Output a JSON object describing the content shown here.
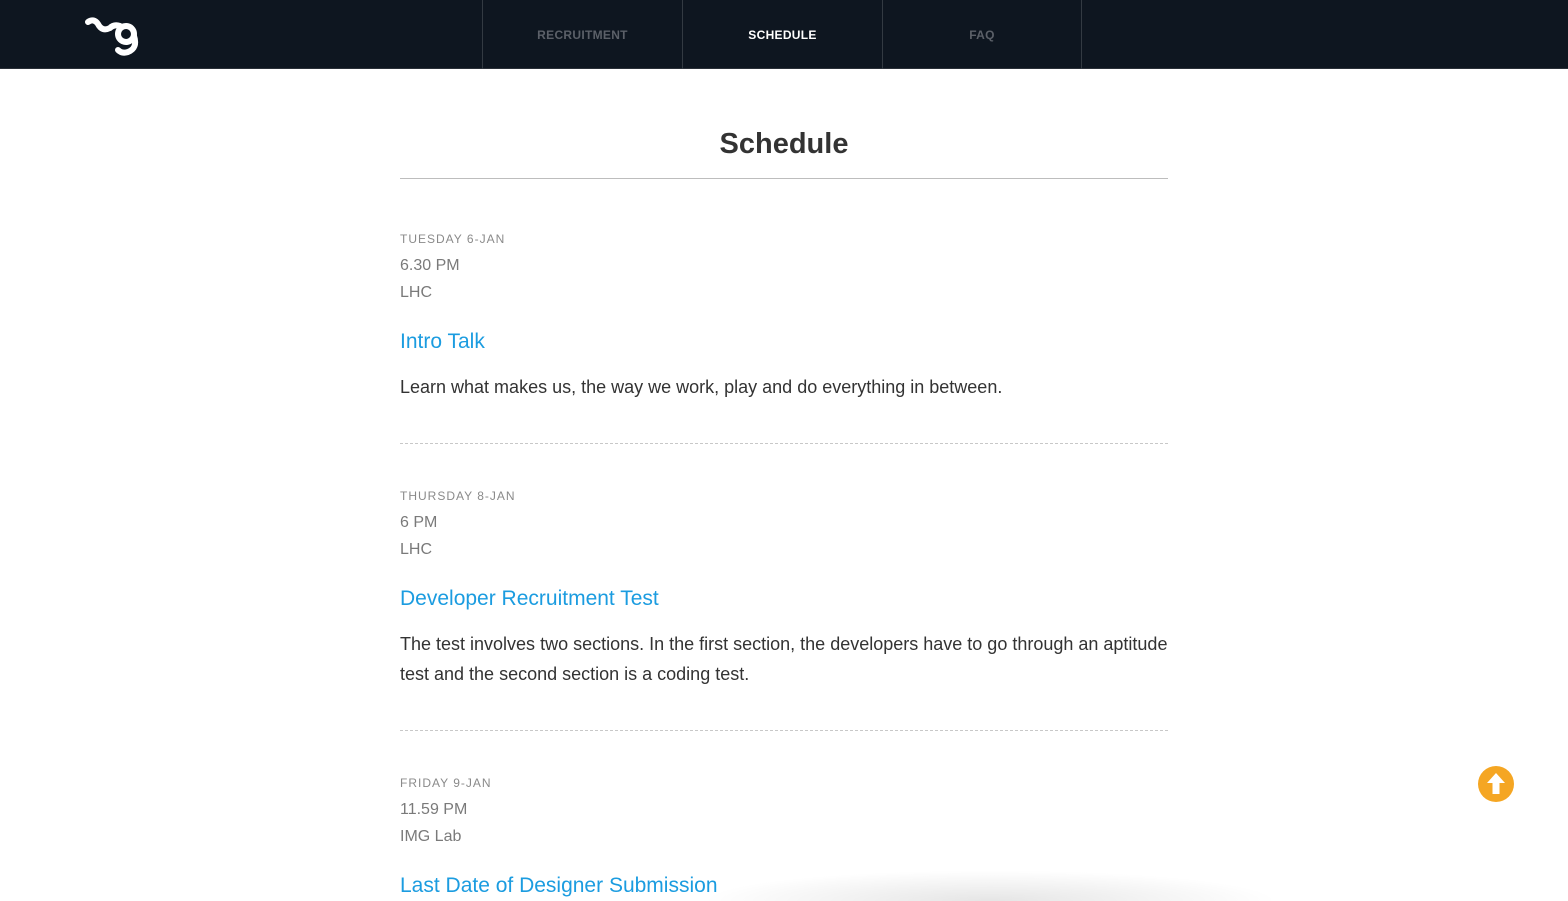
{
  "header": {
    "logo_icon": "img-logo-icon",
    "nav": [
      {
        "label": "RECRUITMENT",
        "active": false
      },
      {
        "label": "SCHEDULE",
        "active": true
      },
      {
        "label": "FAQ",
        "active": false
      }
    ]
  },
  "page": {
    "title": "Schedule"
  },
  "events": [
    {
      "day": "TUESDAY 6-JAN",
      "time": "6.30 PM",
      "place": "LHC",
      "title": "Intro Talk",
      "description": "Learn what makes us, the way we work, play and do everything in between."
    },
    {
      "day": "THURSDAY 8-JAN",
      "time": "6 PM",
      "place": "LHC",
      "title": "Developer Recruitment Test",
      "description": "The test involves two sections. In the first section, the developers have to go through an aptitude test and the second section is a coding test."
    },
    {
      "day": "FRIDAY 9-JAN",
      "time": "11.59 PM",
      "place": "IMG Lab",
      "title": "Last Date of Designer Submission",
      "description": ""
    }
  ],
  "scroll_top": {
    "icon": "arrow-up-circle-icon",
    "color": "#f5a623"
  },
  "colors": {
    "header_bg": "#0e1620",
    "link": "#1b9ce0"
  }
}
